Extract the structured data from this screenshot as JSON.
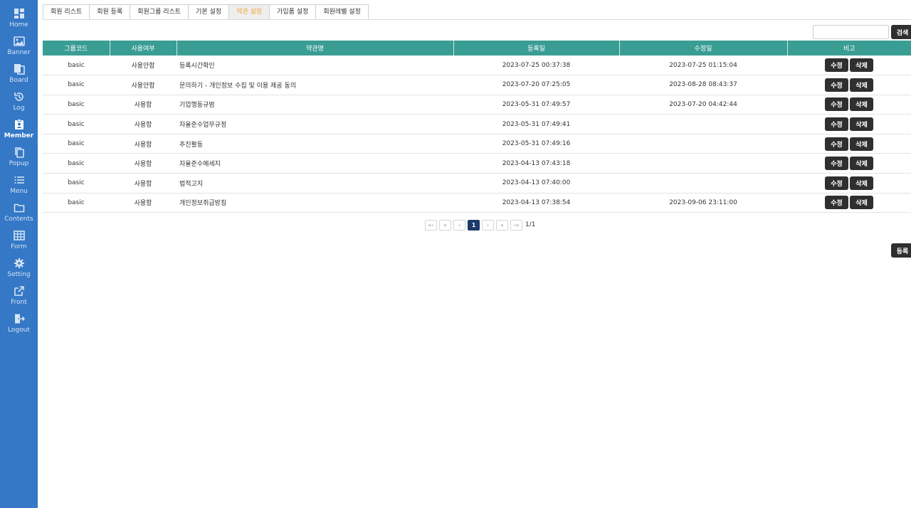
{
  "sidebar": {
    "items": [
      {
        "label": "Home",
        "icon": "dashboard-icon"
      },
      {
        "label": "Banner",
        "icon": "image-icon"
      },
      {
        "label": "Board",
        "icon": "board-icon"
      },
      {
        "label": "Log",
        "icon": "history-icon"
      },
      {
        "label": "Member",
        "icon": "member-badge-icon"
      },
      {
        "label": "Popup",
        "icon": "copy-icon"
      },
      {
        "label": "Menu",
        "icon": "list-icon"
      },
      {
        "label": "Contents",
        "icon": "folder-icon"
      },
      {
        "label": "Form",
        "icon": "table-icon"
      },
      {
        "label": "Setting",
        "icon": "gear-icon"
      },
      {
        "label": "Front",
        "icon": "external-link-icon"
      },
      {
        "label": "Logout",
        "icon": "logout-icon"
      }
    ],
    "active": "Member",
    "color": "#3478c6"
  },
  "tabs": [
    {
      "label": "회원 리스트"
    },
    {
      "label": "회원 등록"
    },
    {
      "label": "회원그룹 리스트"
    },
    {
      "label": "기본 설정"
    },
    {
      "label": "약관 설정"
    },
    {
      "label": "가입폼 설정"
    },
    {
      "label": "회원레벨 설정"
    }
  ],
  "active_tab": "약관 설정",
  "search": {
    "placeholder": "",
    "value": "",
    "button_label": "검색"
  },
  "table": {
    "headers": {
      "group_code": "그룹코드",
      "usage": "사용여부",
      "terms_name": "약관명",
      "reg_date": "등록일",
      "mod_date": "수정일",
      "note": "비고"
    },
    "header_color": "#3a9d94",
    "rows": [
      {
        "group": "basic",
        "usage": "사용안함",
        "name": "등록시간확인",
        "reg": "2023-07-25 00:37:38",
        "mod": "2023-07-25 01:15:04"
      },
      {
        "group": "basic",
        "usage": "사용안함",
        "name": "문의하기 - 개인정보 수집 및 이용 제공 동의",
        "reg": "2023-07-20 07:25:05",
        "mod": "2023-08-28 08:43:37"
      },
      {
        "group": "basic",
        "usage": "사용함",
        "name": "기업행동규범",
        "reg": "2023-05-31 07:49:57",
        "mod": "2023-07-20 04:42:44"
      },
      {
        "group": "basic",
        "usage": "사용함",
        "name": "자율준수업무규정",
        "reg": "2023-05-31 07:49:41",
        "mod": ""
      },
      {
        "group": "basic",
        "usage": "사용함",
        "name": "추진활동",
        "reg": "2023-05-31 07:49:16",
        "mod": ""
      },
      {
        "group": "basic",
        "usage": "사용함",
        "name": "자율준수메세지",
        "reg": "2023-04-13 07:43:18",
        "mod": ""
      },
      {
        "group": "basic",
        "usage": "사용함",
        "name": "법적고지",
        "reg": "2023-04-13 07:40:00",
        "mod": ""
      },
      {
        "group": "basic",
        "usage": "사용함",
        "name": "개인정보취급방침",
        "reg": "2023-04-13 07:38:54",
        "mod": "2023-09-06 23:11:00"
      }
    ],
    "edit_label": "수정",
    "delete_label": "삭제"
  },
  "pagination": {
    "first": "«‹",
    "prev_block": "«",
    "prev": "‹",
    "current": "1",
    "next": "›",
    "next_block": "»",
    "last": "›»",
    "total": "1/1"
  },
  "register_label": "등록"
}
